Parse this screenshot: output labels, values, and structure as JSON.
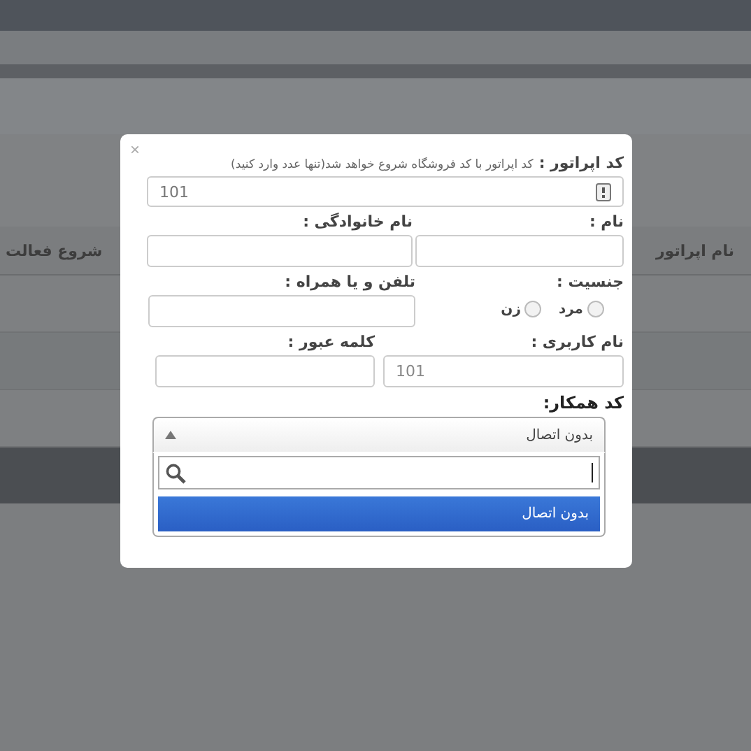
{
  "background_table": {
    "columns": [
      "نام اپراتور",
      "شروع فعالت"
    ]
  },
  "dialog": {
    "close": "×",
    "operator_code": {
      "label": "کد اپراتور :",
      "hint": "کد اپراتور با کد فروشگاه شروع خواهد شد(تنها عدد وارد کنید)",
      "value": "101"
    },
    "first_name": {
      "label": "نام :"
    },
    "last_name": {
      "label": "نام خانوادگی :"
    },
    "gender": {
      "label": "جنسیت :",
      "options": [
        {
          "label": "مرد",
          "selected": false
        },
        {
          "label": "زن",
          "selected": false
        }
      ]
    },
    "phone": {
      "label": "تلفن و یا همراه :"
    },
    "username": {
      "label": "نام کاربری :",
      "value": "101",
      "disabled": true
    },
    "password": {
      "label": "کلمه عبور :"
    },
    "partner_code": {
      "label": "کد همکار:",
      "value": "بدون اتصال",
      "expanded": true,
      "options": [
        {
          "label": "بدون اتصال",
          "selected": true
        }
      ]
    }
  }
}
